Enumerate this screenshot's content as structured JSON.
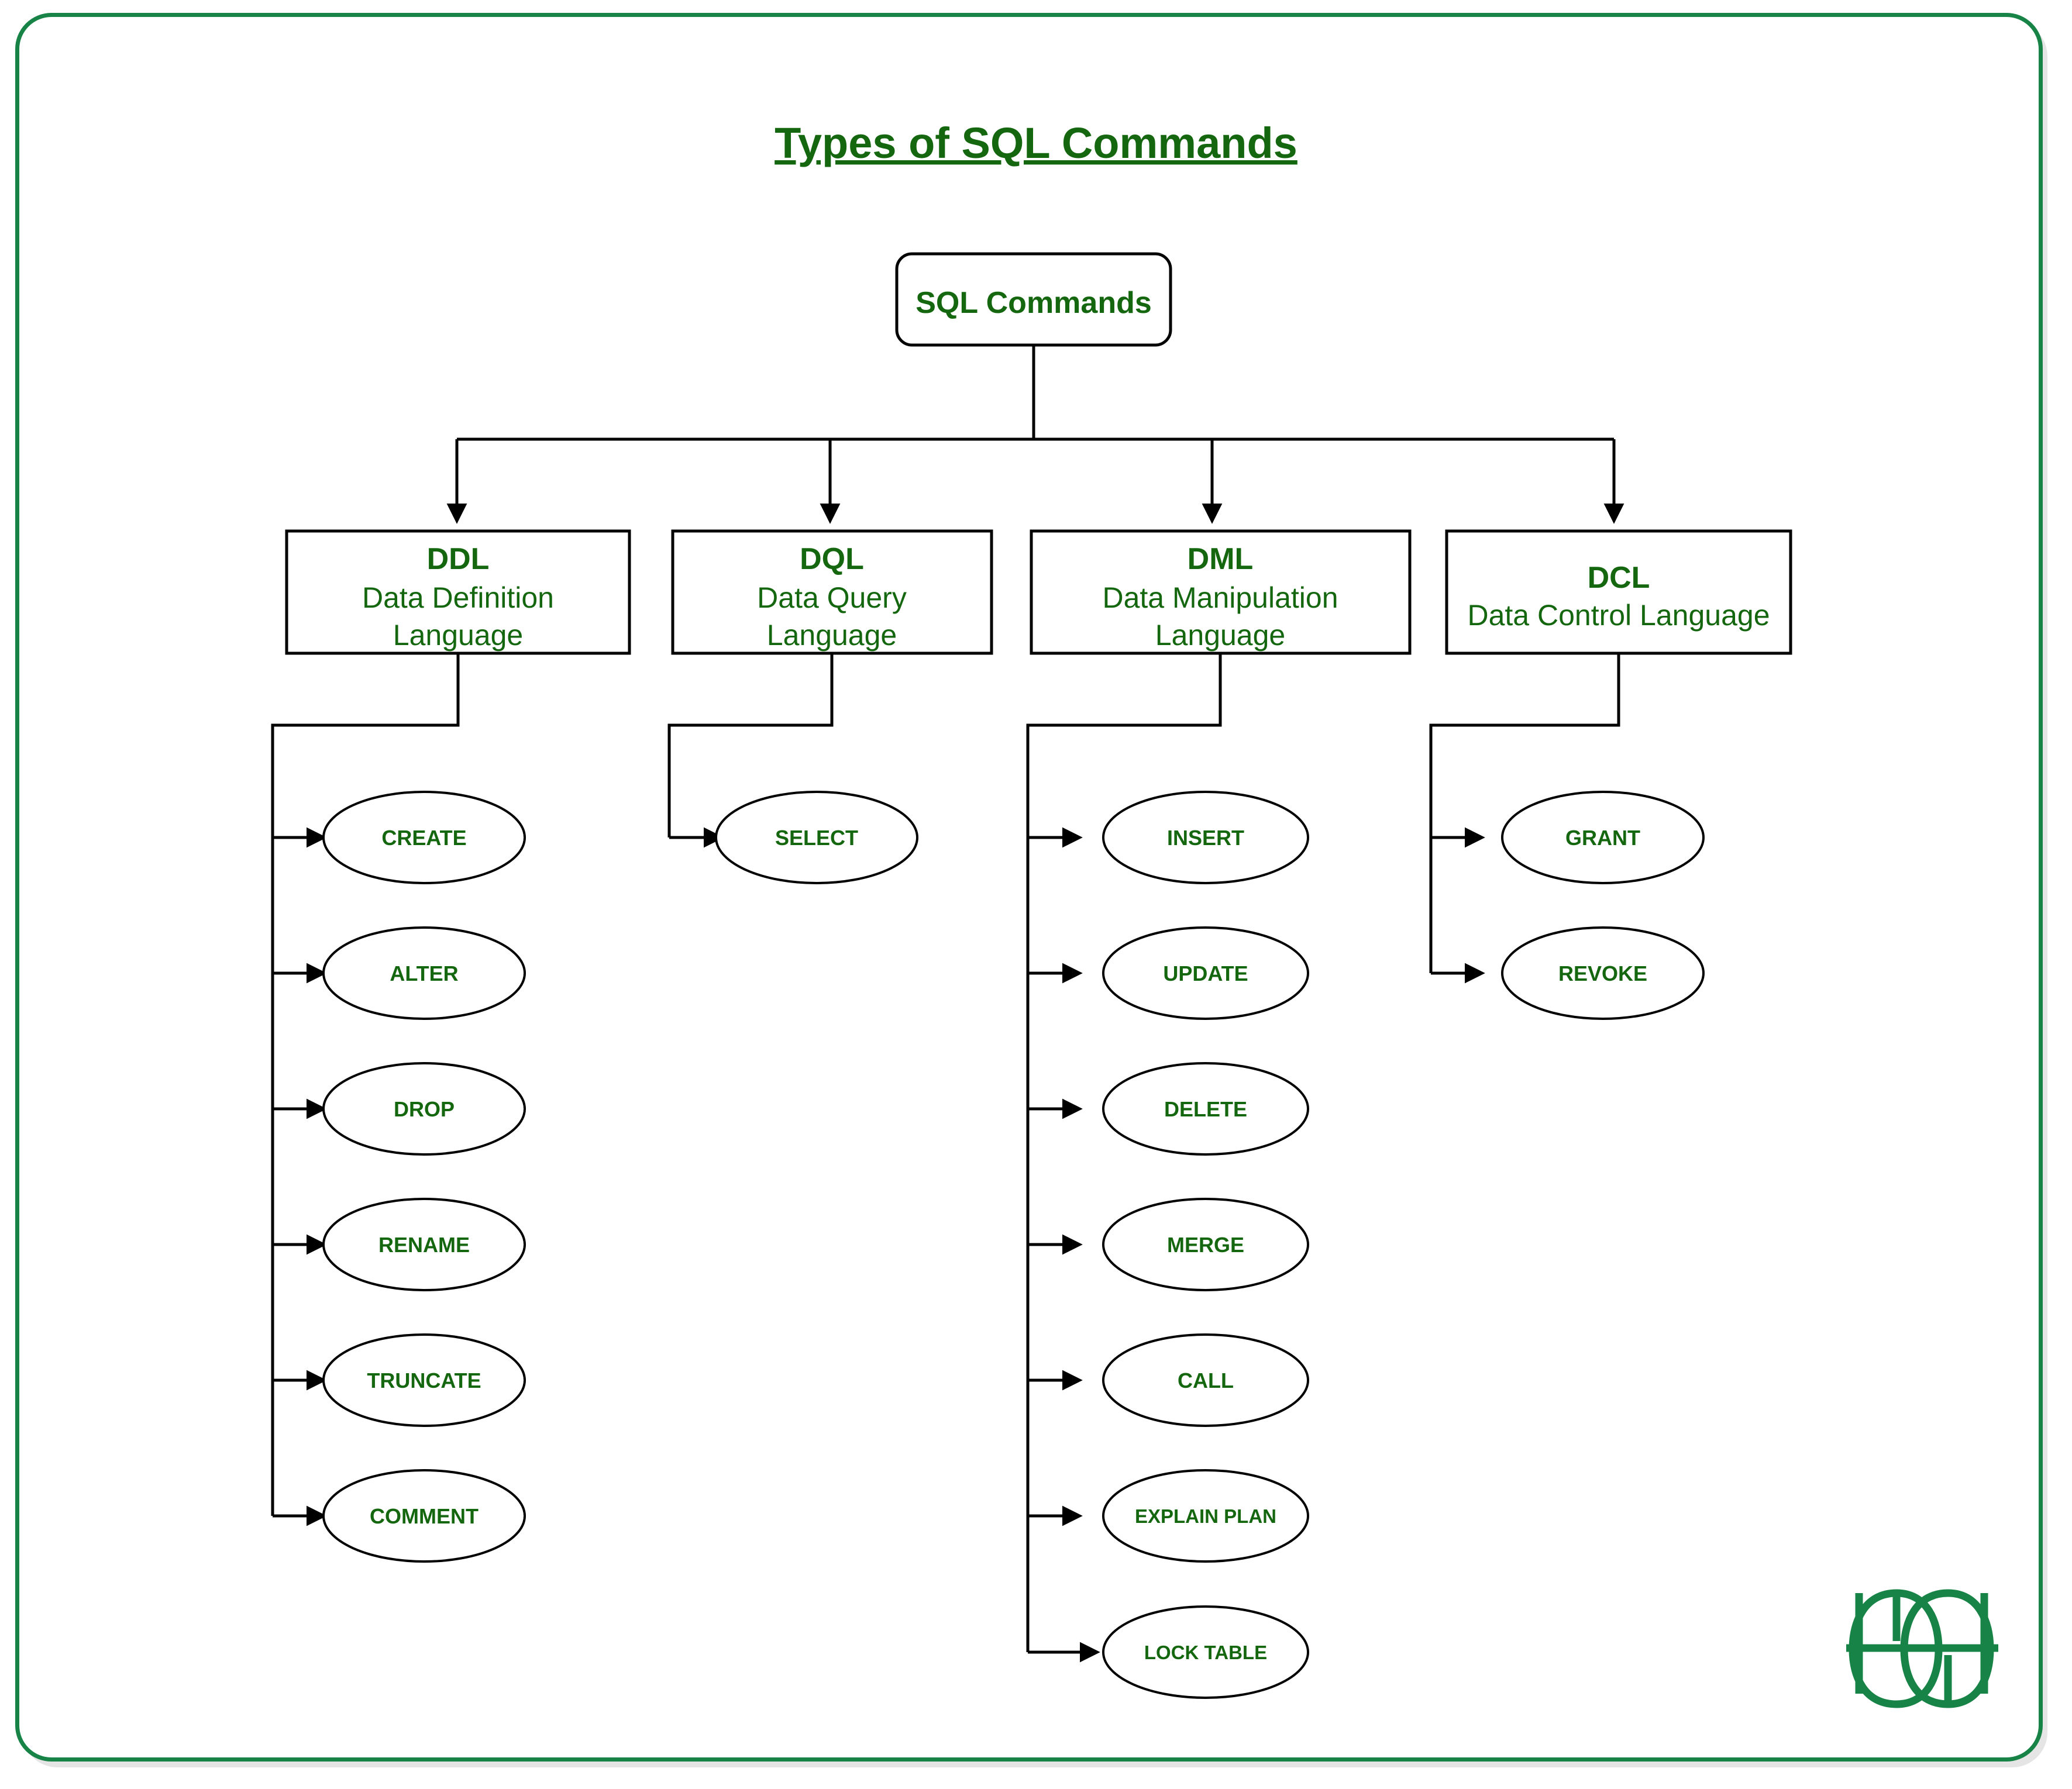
{
  "page": {
    "title": "Types of SQL Commands",
    "brand_logo": "geeksforgeeks-logo",
    "accent_color": "#188346",
    "text_color": "#14670f",
    "line_color": "#000000",
    "background_color": "#ffffff"
  },
  "chart_data": {
    "type": "diagram",
    "diagram_kind": "tree-hierarchy",
    "title": "Types of SQL Commands",
    "root": {
      "id": "root",
      "label": "SQL Commands",
      "shape": "rounded-rect"
    },
    "categories": [
      {
        "id": "ddl",
        "abbr": "DDL",
        "full_name_line1": "Data Definition",
        "full_name_line2": "Language",
        "full_name": "Data Definition Language",
        "shape": "rect",
        "commands": [
          "CREATE",
          "ALTER",
          "DROP",
          "RENAME",
          "TRUNCATE",
          "COMMENT"
        ]
      },
      {
        "id": "dql",
        "abbr": "DQL",
        "full_name_line1": "Data Query",
        "full_name_line2": "Language",
        "full_name": "Data Query Language",
        "shape": "rect",
        "commands": [
          "SELECT"
        ]
      },
      {
        "id": "dml",
        "abbr": "DML",
        "full_name_line1": "Data Manipulation",
        "full_name_line2": "Language",
        "full_name": "Data Manipulation Language",
        "shape": "rect",
        "commands": [
          "INSERT",
          "UPDATE",
          "DELETE",
          "MERGE",
          "CALL",
          "EXPLAIN PLAN",
          "LOCK TABLE"
        ]
      },
      {
        "id": "dcl",
        "abbr": "DCL",
        "full_name_line1": "Data Control Language",
        "full_name_line2": "",
        "full_name": "Data Control Language",
        "shape": "rect",
        "commands": [
          "GRANT",
          "REVOKE"
        ]
      }
    ]
  },
  "nodes": {
    "root_label": "SQL Commands",
    "ddl_abbr": "DDL",
    "ddl_line1": "Data Definition",
    "ddl_line2": "Language",
    "dql_abbr": "DQL",
    "dql_line1": "Data Query",
    "dql_line2": "Language",
    "dml_abbr": "DML",
    "dml_line1": "Data Manipulation",
    "dml_line2": "Language",
    "dcl_abbr": "DCL",
    "dcl_line1": "Data Control Language",
    "ddl_cmd_1": "CREATE",
    "ddl_cmd_2": "ALTER",
    "ddl_cmd_3": "DROP",
    "ddl_cmd_4": "RENAME",
    "ddl_cmd_5": "TRUNCATE",
    "ddl_cmd_6": "COMMENT",
    "dql_cmd_1": "SELECT",
    "dml_cmd_1": "INSERT",
    "dml_cmd_2": "UPDATE",
    "dml_cmd_3": "DELETE",
    "dml_cmd_4": "MERGE",
    "dml_cmd_5": "CALL",
    "dml_cmd_6": "EXPLAIN PLAN",
    "dml_cmd_7": "LOCK TABLE",
    "dcl_cmd_1": "GRANT",
    "dcl_cmd_2": "REVOKE"
  }
}
